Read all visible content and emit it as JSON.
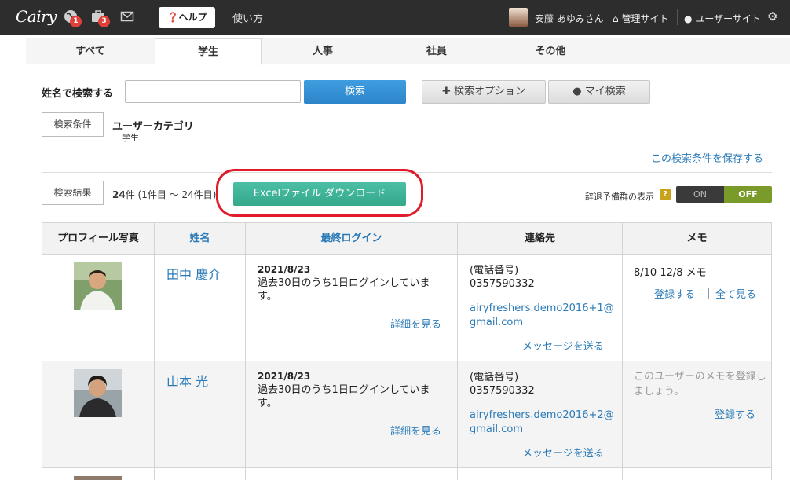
{
  "topbar": {
    "logo": "Cairy",
    "globe_badge": "1",
    "briefcase_badge": "3",
    "help_label": "ヘルプ",
    "usage_label": "使い方",
    "user_name": "安藤 あゆみさん",
    "admin_link": "管理サイト",
    "user_site_link": "ユーザーサイト"
  },
  "tabs": [
    "すべて",
    "学生",
    "人事",
    "社員",
    "その他"
  ],
  "active_tab": "学生",
  "search": {
    "label": "姓名で検索する",
    "input_value": "",
    "search_button": "検索",
    "option_button": "検索オプション",
    "my_search_button": "マイ検索"
  },
  "conditions": {
    "box_label": "検索条件",
    "category_title": "ユーザーカテゴリ",
    "category_value": "学生",
    "save_link": "この検索条件を保存する"
  },
  "results": {
    "box_label": "検索結果",
    "count_bold": "24",
    "count_text": "件 (1件目 ～ 24件目)",
    "excel_button": "Excelファイル ダウンロード",
    "toggle_label": "辞退予備群の表示",
    "toggle_help": "?",
    "toggle_on": "ON",
    "toggle_off": "OFF",
    "toggle_state": "OFF"
  },
  "table": {
    "headers": [
      "プロフィール写真",
      "姓名",
      "最終ログイン",
      "連絡先",
      "メモ"
    ],
    "rows": [
      {
        "name": "田中 慶介",
        "login_date": "2021/8/23",
        "login_text": "過去30日のうち1日ログインしています。",
        "detail_link": "詳細を見る",
        "phone_label": "(電話番号)",
        "phone": "0357590332",
        "email": "airyfreshers.demo2016+1@gmail.com",
        "message_link": "メッセージを送る",
        "memo": "8/10 12/8 メモ",
        "memo_register": "登録する",
        "memo_all": "全て見る"
      },
      {
        "name": "山本 光",
        "login_date": "2021/8/23",
        "login_text": "過去30日のうち1日ログインしています。",
        "detail_link": "詳細を見る",
        "phone_label": "(電話番号)",
        "phone": "0357590332",
        "email": "airyfreshers.demo2016+2@gmail.com",
        "message_link": "メッセージを送る",
        "memo_placeholder": "このユーザーのメモを登録しましょう。",
        "memo_register": "登録する"
      }
    ]
  },
  "colors": {
    "topbar": "#2d2d2d",
    "link": "#2a7ab8",
    "primary_button": "#2d85c9",
    "excel_button": "#34a88b",
    "highlight_ring": "#e01b2c",
    "toggle_off": "#7a9a2a",
    "badge": "#e0403a"
  }
}
